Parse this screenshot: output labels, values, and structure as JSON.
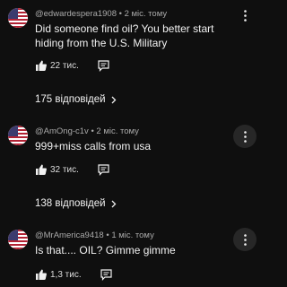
{
  "comments": [
    {
      "author": "@edwardespera1908",
      "time": "2 міс. тому",
      "text": "Did someone find oil? You better start hiding from the U.S. Military",
      "likes": "22 тис.",
      "replies": "175 відповідей"
    },
    {
      "author": "@AmOng-c1v",
      "time": "2 міс. тому",
      "text": "999+miss calls from usa",
      "likes": "32 тис.",
      "replies": "138 відповідей"
    },
    {
      "author": "@MrAmerica9418",
      "time": "1 міс. тому",
      "text": "Is that.... OIL? Gimme gimme",
      "likes": "1,3 тис."
    }
  ],
  "separator": " • ",
  "icons": {
    "avatar": "us-flag-icon",
    "like": "thumbs-up-icon",
    "reply": "reply-comment-icon",
    "more": "more-vertical-icon",
    "expand": "chevron-right-icon"
  }
}
